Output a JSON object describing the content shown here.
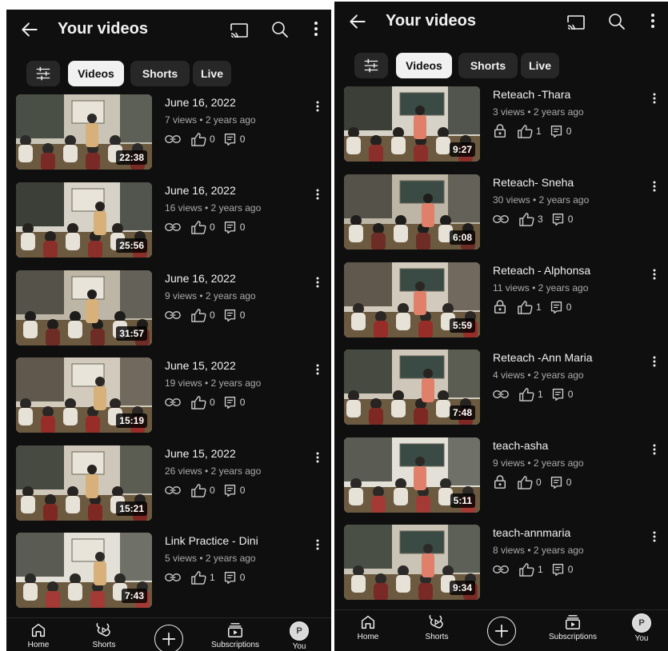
{
  "panels": [
    {
      "header": {
        "title": "Your videos"
      },
      "chips": [
        {
          "label": "Videos",
          "active": true
        },
        {
          "label": "Shorts",
          "active": false
        },
        {
          "label": "Live",
          "active": false
        }
      ],
      "videos": [
        {
          "title": "June 16, 2022",
          "meta": "7 views • 2 years ago",
          "duration": "22:38",
          "visibility": "unlisted",
          "likes": "0",
          "comments": "0"
        },
        {
          "title": "June 16, 2022",
          "meta": "16 views • 2 years ago",
          "duration": "25:56",
          "visibility": "unlisted",
          "likes": "0",
          "comments": "0"
        },
        {
          "title": "June 16, 2022",
          "meta": "9 views • 2 years ago",
          "duration": "31:57",
          "visibility": "unlisted",
          "likes": "0",
          "comments": "0"
        },
        {
          "title": "June 15, 2022",
          "meta": "19 views • 2 years ago",
          "duration": "15:19",
          "visibility": "unlisted",
          "likes": "0",
          "comments": "0"
        },
        {
          "title": "June 15, 2022",
          "meta": "26 views • 2 years ago",
          "duration": "15:21",
          "visibility": "unlisted",
          "likes": "0",
          "comments": "0"
        },
        {
          "title": "Link Practice - Dini",
          "meta": "5 views • 2 years ago",
          "duration": "7:43",
          "visibility": "unlisted",
          "likes": "1",
          "comments": "0"
        }
      ],
      "nav": [
        {
          "label": "Home",
          "icon": "home-icon"
        },
        {
          "label": "Shorts",
          "icon": "shorts-icon"
        },
        {
          "label": "",
          "icon": "create-icon"
        },
        {
          "label": "Subscriptions",
          "icon": "subscriptions-icon"
        },
        {
          "label": "You",
          "icon": "avatar",
          "avatar_letter": "P"
        }
      ]
    },
    {
      "header": {
        "title": "Your videos"
      },
      "chips": [
        {
          "label": "Videos",
          "active": true
        },
        {
          "label": "Shorts",
          "active": false
        },
        {
          "label": "Live",
          "active": false
        }
      ],
      "videos": [
        {
          "title": "Reteach -Thara",
          "meta": "3 views • 2 years ago",
          "duration": "9:27",
          "visibility": "private",
          "likes": "1",
          "comments": "0"
        },
        {
          "title": "Reteach- Sneha",
          "meta": "30 views • 2 years ago",
          "duration": "6:08",
          "visibility": "unlisted",
          "likes": "3",
          "comments": "0"
        },
        {
          "title": "Reteach - Alphonsa",
          "meta": "11 views • 2 years ago",
          "duration": "5:59",
          "visibility": "private",
          "likes": "1",
          "comments": "0"
        },
        {
          "title": "Reteach -Ann Maria",
          "meta": "4 views • 2 years ago",
          "duration": "7:48",
          "visibility": "unlisted",
          "likes": "1",
          "comments": "0"
        },
        {
          "title": "teach-asha",
          "meta": "9 views • 2 years ago",
          "duration": "5:11",
          "visibility": "private",
          "likes": "0",
          "comments": "0"
        },
        {
          "title": "teach-annmaria",
          "meta": "8 views • 2 years ago",
          "duration": "9:34",
          "visibility": "unlisted",
          "likes": "1",
          "comments": "0"
        }
      ],
      "nav": [
        {
          "label": "Home",
          "icon": "home-icon"
        },
        {
          "label": "Shorts",
          "icon": "shorts-icon"
        },
        {
          "label": "",
          "icon": "create-icon"
        },
        {
          "label": "Subscriptions",
          "icon": "subscriptions-icon"
        },
        {
          "label": "You",
          "icon": "avatar",
          "avatar_letter": "P"
        }
      ]
    }
  ],
  "colors": {
    "background": "#0f0f0f",
    "chip": "#272727",
    "chip_active": "#f1f1f1",
    "meta_text": "#aaaaaa"
  }
}
